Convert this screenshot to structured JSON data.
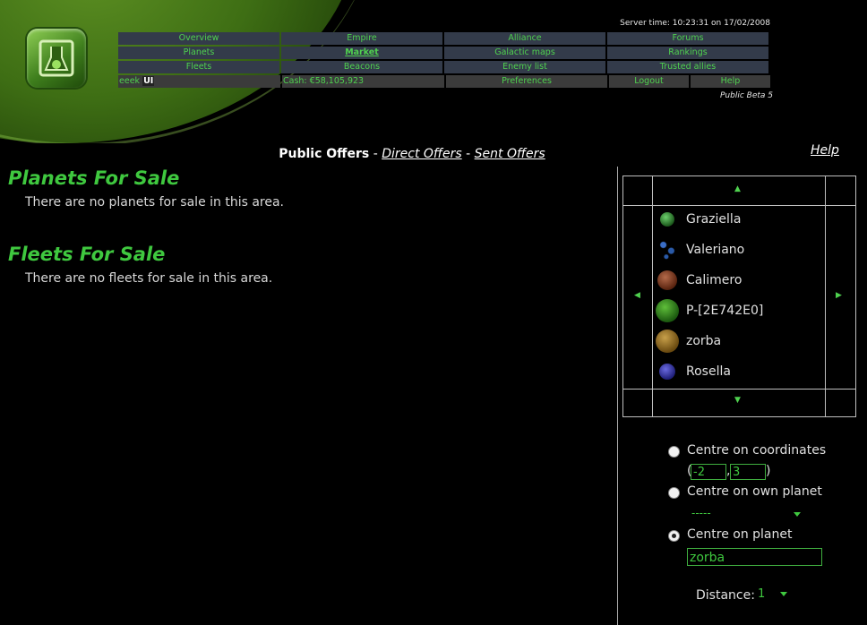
{
  "header": {
    "server_time": "Server time: 10:23:31 on 17/02/2008",
    "beta_label": "Public Beta 5"
  },
  "nav": {
    "rows": [
      [
        "Overview",
        "Empire",
        "Alliance",
        "Forums"
      ],
      [
        "Planets",
        "Market",
        "Galactic maps",
        "Rankings"
      ],
      [
        "Fleets",
        "Beacons",
        "Enemy list",
        "Trusted allies"
      ]
    ],
    "active": "Market",
    "user_name": "eeek",
    "ui_tag": "UI",
    "cash": "Cash: €58,105,923",
    "preferences": "Preferences",
    "logout": "Logout",
    "help": "Help"
  },
  "offers_tabs": {
    "current": "Public Offers",
    "sep": " - ",
    "direct": "Direct Offers",
    "sent": "Sent Offers"
  },
  "help_link": "Help",
  "planets_section": {
    "title": "Planets For Sale",
    "empty_text": "There are no planets for sale in this area."
  },
  "fleets_section": {
    "title": "Fleets For Sale",
    "empty_text": "There are no fleets for sale in this area."
  },
  "map": {
    "arrow_up": "▲",
    "arrow_down": "▼",
    "arrow_left": "◀",
    "arrow_right": "▶",
    "planets": [
      {
        "name": "Graziella",
        "color": "#2f7a2f"
      },
      {
        "name": "Valeriano",
        "color": "#1a3a6e"
      },
      {
        "name": "Calimero",
        "color": "#7a3a22"
      },
      {
        "name": "P-[2E742E0]",
        "color": "#2f8a2f"
      },
      {
        "name": "zorba",
        "color": "#8a6a22"
      },
      {
        "name": "Rosella",
        "color": "#3a3aa8"
      }
    ]
  },
  "controls": {
    "centre_coords_label": "Centre on coordinates",
    "coord_open": "(",
    "coord_sep": ",",
    "coord_close": ")",
    "coord_x": "-2",
    "coord_y": "3",
    "centre_own_label": "Centre on own planet",
    "own_planet_value": "-----",
    "centre_planet_label": "Centre on planet",
    "planet_value": "zorba",
    "distance_label": "Distance:",
    "distance_value": "1",
    "selected": "centre_planet"
  }
}
